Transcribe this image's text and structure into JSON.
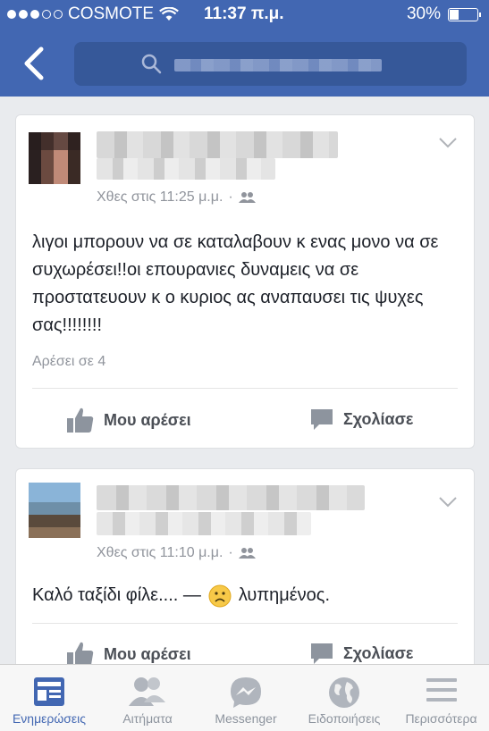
{
  "status_bar": {
    "carrier": "COSMOTE",
    "time": "11:37 π.μ.",
    "battery": "30%",
    "battery_level": 0.3
  },
  "posts": [
    {
      "timestamp": "Χθες στις 11:25 μ.μ.",
      "text": "λιγοι μπορουν να σε καταλαβουν κ ενας μονο να σε συχωρέσει!!οι επουρανιες δυναμεις να σε προστατευουν κ ο κυριος ας αναπαυσει τις ψυχες σας!!!!!!!!",
      "likes": "Αρέσει σε 4",
      "like_label": "Μου αρέσει",
      "comment_label": "Σχολίασε"
    },
    {
      "timestamp": "Χθες στις 11:10 μ.μ.",
      "text": "Καλό ταξίδι φίλε.... —",
      "feeling": "λυπημένος.",
      "like_label": "Μου αρέσει",
      "comment_label": "Σχολίασε"
    }
  ],
  "tabs": [
    {
      "label": "Ενημερώσεις",
      "icon": "news-feed-icon"
    },
    {
      "label": "Αιτήματα",
      "icon": "friend-requests-icon"
    },
    {
      "label": "Messenger",
      "icon": "messenger-icon"
    },
    {
      "label": "Ειδοποιήσεις",
      "icon": "globe-icon"
    },
    {
      "label": "Περισσότερα",
      "icon": "menu-icon"
    }
  ],
  "colors": {
    "brand": "#4267b2",
    "background": "#e9ebee",
    "secondary_text": "#90949c"
  }
}
